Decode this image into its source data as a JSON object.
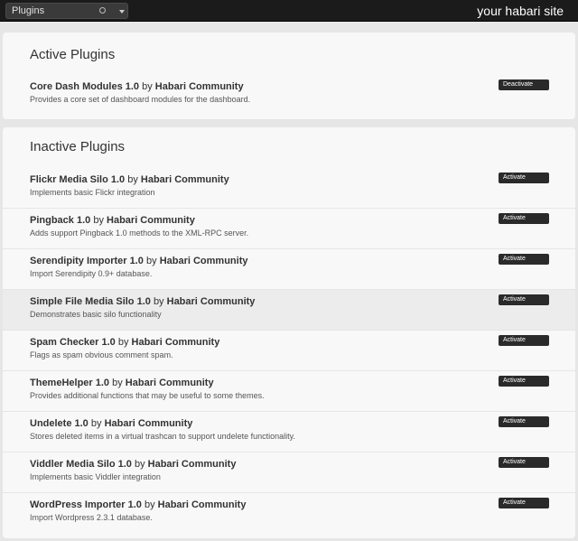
{
  "header": {
    "menu_label": "Plugins",
    "site_title": "your habari site"
  },
  "active": {
    "heading": "Active Plugins",
    "plugins": [
      {
        "name": "Core Dash Modules 1.0",
        "by": "by",
        "author": "Habari Community",
        "description": "Provides a core set of dashboard modules for the dashboard.",
        "button": "Deactivate"
      }
    ]
  },
  "inactive": {
    "heading": "Inactive Plugins",
    "plugins": [
      {
        "name": "Flickr Media Silo 1.0",
        "by": "by",
        "author": "Habari Community",
        "description": "Implements basic Flickr integration",
        "button": "Activate"
      },
      {
        "name": "Pingback 1.0",
        "by": "by",
        "author": "Habari Community",
        "description": "Adds support Pingback 1.0 methods to the XML-RPC server.",
        "button": "Activate"
      },
      {
        "name": "Serendipity Importer 1.0",
        "by": "by",
        "author": "Habari Community",
        "description": "Import Serendipity 0.9+ database.",
        "button": "Activate"
      },
      {
        "name": "Simple File Media Silo 1.0",
        "by": "by",
        "author": "Habari Community",
        "description": "Demonstrates basic silo functionality",
        "button": "Activate"
      },
      {
        "name": "Spam Checker 1.0",
        "by": "by",
        "author": "Habari Community",
        "description": "Flags as spam obvious comment spam.",
        "button": "Activate"
      },
      {
        "name": "ThemeHelper 1.0",
        "by": "by",
        "author": "Habari Community",
        "description": "Provides additional functions that may be useful to some themes.",
        "button": "Activate"
      },
      {
        "name": "Undelete 1.0",
        "by": "by",
        "author": "Habari Community",
        "description": "Stores deleted items in a virtual trashcan to support undelete functionality.",
        "button": "Activate"
      },
      {
        "name": "Viddler Media Silo 1.0",
        "by": "by",
        "author": "Habari Community",
        "description": "Implements basic Viddler integration",
        "button": "Activate"
      },
      {
        "name": "WordPress Importer 1.0",
        "by": "by",
        "author": "Habari Community",
        "description": "Import Wordpress 2.3.1 database.",
        "button": "Activate"
      }
    ]
  },
  "colors": {
    "topbar": "#1b1b1b",
    "button": "#2a2a2a",
    "panel": "#f8f8f8",
    "background": "#e6e6e6"
  }
}
